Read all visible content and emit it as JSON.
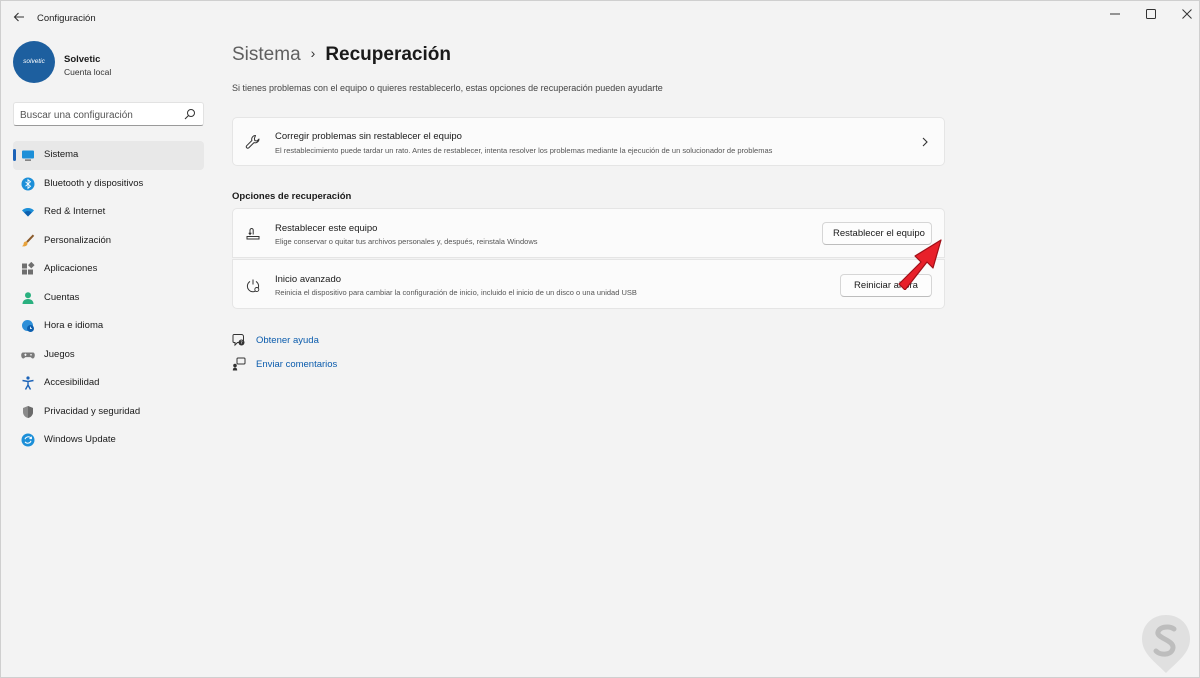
{
  "window": {
    "title": "Configuración"
  },
  "profile": {
    "name": "Solvetic",
    "account_type": "Cuenta local",
    "avatar_text": "solvetic"
  },
  "search": {
    "placeholder": "Buscar una configuración"
  },
  "sidebar": {
    "items": [
      {
        "label": "Sistema",
        "icon": "monitor-icon",
        "active": true
      },
      {
        "label": "Bluetooth y dispositivos",
        "icon": "bluetooth-icon"
      },
      {
        "label": "Red & Internet",
        "icon": "wifi-icon"
      },
      {
        "label": "Personalización",
        "icon": "paintbrush-icon"
      },
      {
        "label": "Aplicaciones",
        "icon": "apps-icon"
      },
      {
        "label": "Cuentas",
        "icon": "person-icon"
      },
      {
        "label": "Hora e idioma",
        "icon": "globe-clock-icon"
      },
      {
        "label": "Juegos",
        "icon": "gamepad-icon"
      },
      {
        "label": "Accesibilidad",
        "icon": "accessibility-icon"
      },
      {
        "label": "Privacidad y seguridad",
        "icon": "shield-icon"
      },
      {
        "label": "Windows Update",
        "icon": "update-icon"
      }
    ]
  },
  "breadcrumb": {
    "parent": "Sistema",
    "separator": "›",
    "current": "Recuperación"
  },
  "main": {
    "subtitle": "Si tienes problemas con el equipo o quieres restablecerlo, estas opciones de recuperación pueden ayudarte",
    "fix_card": {
      "title": "Corregir problemas sin restablecer el equipo",
      "description": "El restablecimiento puede tardar un rato. Antes de restablecer, intenta resolver los problemas mediante la ejecución de un solucionador de problemas",
      "icon": "wrench-icon"
    },
    "recovery_section": {
      "header": "Opciones de recuperación",
      "reset": {
        "title": "Restablecer este equipo",
        "description": "Elige conservar o quitar tus archivos personales y, después, reinstala Windows",
        "button": "Restablecer el equipo",
        "icon": "reset-pc-icon"
      },
      "advanced": {
        "title": "Inicio avanzado",
        "description": "Reinicia el dispositivo para cambiar la configuración de inicio, incluido el inicio de un disco o una unidad USB",
        "button": "Reiniciar ahora",
        "icon": "advanced-startup-icon"
      }
    },
    "links": [
      {
        "label": "Obtener ayuda",
        "icon": "help-icon"
      },
      {
        "label": "Enviar comentarios",
        "icon": "feedback-icon"
      }
    ]
  },
  "colors": {
    "accent": "#1c63b8",
    "link": "#0b5cad",
    "annotation_arrow": "#e8202a",
    "avatar_bg": "#1d5f9f"
  }
}
